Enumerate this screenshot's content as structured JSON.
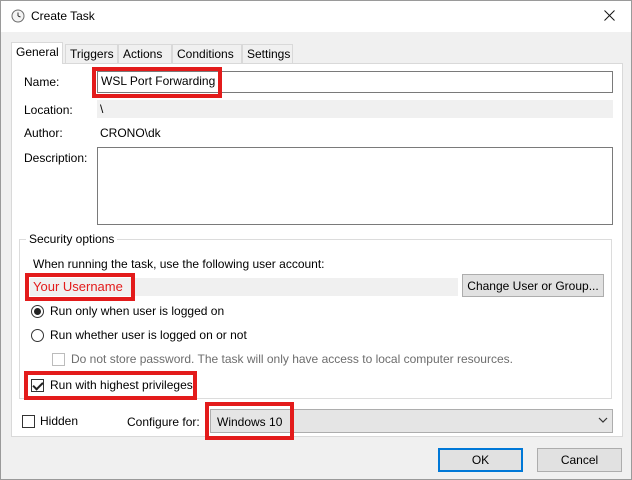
{
  "window": {
    "title": "Create Task",
    "title_icon": "clock-icon",
    "close_icon": "close-icon"
  },
  "tabs": [
    {
      "label": "General",
      "active": true
    },
    {
      "label": "Triggers",
      "active": false
    },
    {
      "label": "Actions",
      "active": false
    },
    {
      "label": "Conditions",
      "active": false
    },
    {
      "label": "Settings",
      "active": false
    }
  ],
  "general": {
    "name_label": "Name:",
    "name_value": "WSL Port Forwarding",
    "location_label": "Location:",
    "location_value": "\\",
    "author_label": "Author:",
    "author_value": "CRONO\\dk",
    "description_label": "Description:",
    "description_value": ""
  },
  "security": {
    "group_title": "Security options",
    "account_prompt": "When running the task, use the following user account:",
    "user_account": "Your Username",
    "change_user_button": "Change User or Group...",
    "radio_logged_on": "Run only when user is logged on",
    "radio_logged_on_checked": true,
    "radio_whether": "Run whether user is logged on or not",
    "radio_whether_checked": false,
    "no_store_password": "Do not store password.  The task will only have access to local computer resources.",
    "highest_privileges": "Run with highest privileges",
    "highest_privileges_checked": true
  },
  "bottom": {
    "hidden_label": "Hidden",
    "hidden_checked": false,
    "configure_label": "Configure for:",
    "configure_value": "Windows 10"
  },
  "footer": {
    "ok_button": "OK",
    "cancel_button": "Cancel"
  },
  "colors": {
    "highlight_red": "#e31b1b",
    "accent_blue": "#0078d7"
  }
}
